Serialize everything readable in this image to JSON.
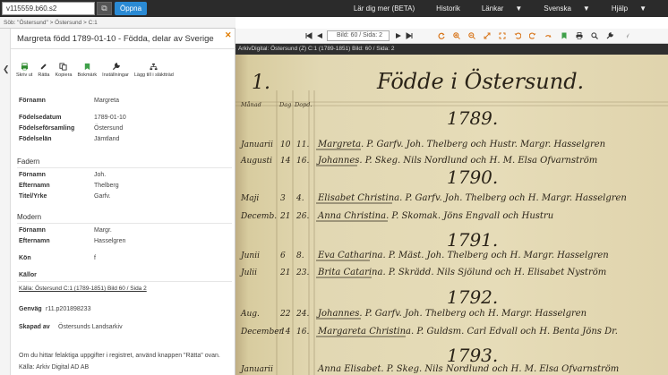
{
  "topbar": {
    "search_value": "v115559.b60.s2",
    "copy_icon": "copy-icon",
    "open_label": "Öppna",
    "menu": [
      {
        "label": "Lär dig mer (BETA)",
        "dropdown": false
      },
      {
        "label": "Historik",
        "dropdown": false
      },
      {
        "label": "Länkar",
        "dropdown": true
      },
      {
        "label": "Svenska",
        "dropdown": true
      },
      {
        "label": "Hjälp",
        "dropdown": true
      }
    ]
  },
  "breadcrumb": "Söb: \"Östersund\" > Östersund > C:1",
  "panel": {
    "title": "Margreta född 1789-01-10 - Födda, delar av Sverige",
    "tools": [
      {
        "label": "Skriv ut",
        "icon": "printer-icon",
        "color": "#2e8b2e"
      },
      {
        "label": "Rätta",
        "icon": "edit-icon",
        "color": "#333333"
      },
      {
        "label": "Kopiera",
        "icon": "copy-icon",
        "color": "#333333"
      },
      {
        "label": "Bokmärk",
        "icon": "bookmark-icon",
        "color": "#3fa04a"
      },
      {
        "label": "Inställningar",
        "icon": "wrench-icon",
        "color": "#333333"
      },
      {
        "label": "Lägg till i släktträd",
        "icon": "tree-icon",
        "color": "#333333"
      }
    ],
    "fields": [
      {
        "key": "Förnamn",
        "value": "Margreta"
      },
      {
        "key": "Födelsedatum",
        "value": "1789-01-10"
      },
      {
        "key": "Födelseförsamling",
        "value": "Östersund"
      },
      {
        "key": "Födelselän",
        "value": "Jämtland"
      }
    ],
    "father_heading": "Fadern",
    "father": [
      {
        "key": "Förnamn",
        "value": "Joh."
      },
      {
        "key": "Efternamn",
        "value": "Thelberg"
      },
      {
        "key": "Titel/Yrke",
        "value": "Garfv."
      }
    ],
    "mother_heading": "Modern",
    "mother": [
      {
        "key": "Förnamn",
        "value": "Margr."
      },
      {
        "key": "Efternamn",
        "value": "Hasselgren"
      }
    ],
    "gender": {
      "key": "Kön",
      "value": "f"
    },
    "sources_heading": "Källor",
    "source_link": "Källa: Östersund C:1 (1789-1851) Bild 60 / Sida 2",
    "genvag": {
      "key": "Genväg",
      "value": "r11.p201898233"
    },
    "created": {
      "key": "Skapad av",
      "value": "Östersunds Landsarkiv"
    },
    "note": "Om du hittar felaktiga uppgifter i registret, använd knappen \"Rätta\" ovan.",
    "source_footer": "Källa: Arkiv Digital AD AB"
  },
  "viewer": {
    "page_selector": "Bild: 60 / Sida: 2",
    "title": "ArkivDigital: Östersund (Z) C:1 (1789-1851) Bild: 60 / Sida: 2",
    "icons": [
      "first-page-icon",
      "prev-page-icon",
      "next-page-icon",
      "last-page-icon",
      "refresh-icon",
      "zoom-in-icon",
      "zoom-out-icon",
      "fit-icon",
      "fullscreen-icon",
      "rotate-left-icon",
      "rotate-right-icon",
      "bookmark-icon",
      "print-icon",
      "search-icon",
      "wrench-icon",
      "cursor-icon"
    ]
  },
  "document": {
    "header_number": "1.",
    "header_title": "Födde i Östersund.",
    "column_heads": [
      "Månad",
      "Dag",
      "Dopd."
    ],
    "year_labels": [
      "1789.",
      "1790.",
      "1791.",
      "1792.",
      "1793."
    ],
    "entries": [
      {
        "month": "Januarii",
        "day": "10",
        "dop": "11.",
        "text": "Margreta. P. Garfv. Joh. Thelberg och Hustr. Margr. Hasselgren"
      },
      {
        "month": "Augusti",
        "day": "14",
        "dop": "16.",
        "text": "Johannes. P. Skeg. Nils Nordlund och H. M. Elsa Ofvarnström"
      },
      {
        "month": "Maji",
        "day": "3",
        "dop": "4.",
        "text": "Elisabet Christina. P. Garfv. Joh. Thelberg och H. Margr. Hasselgren"
      },
      {
        "month": "Decemb.",
        "day": "21",
        "dop": "26.",
        "text": "Anna Christina. P. Skomak. Jöns Engvall och Hustru"
      },
      {
        "month": "Junii",
        "day": "6",
        "dop": "8.",
        "text": "Eva Catharina. P. Mäst. Joh. Thelberg och H. Margr. Hasselgren"
      },
      {
        "month": "Julii",
        "day": "21",
        "dop": "23.",
        "text": "Brita Catarina. P. Skrädd. Nils Sjölund och H. Elisabet Nyström"
      },
      {
        "month": "Aug.",
        "day": "22",
        "dop": "24.",
        "text": "Johannes. P. Garfv. Joh. Thelberg och H. Margr. Hasselgren"
      },
      {
        "month": "December",
        "day": "14",
        "dop": "16.",
        "text": "Margareta Christina. P. Guldsm. Carl Edvall och H. Benta Jöns Dr."
      },
      {
        "month": "Januarii",
        "day": "",
        "dop": "",
        "text": "Anna Elisabet. P. Skeg. Nils Nordlund och H. M. Elsa Ofvarnström"
      }
    ]
  }
}
